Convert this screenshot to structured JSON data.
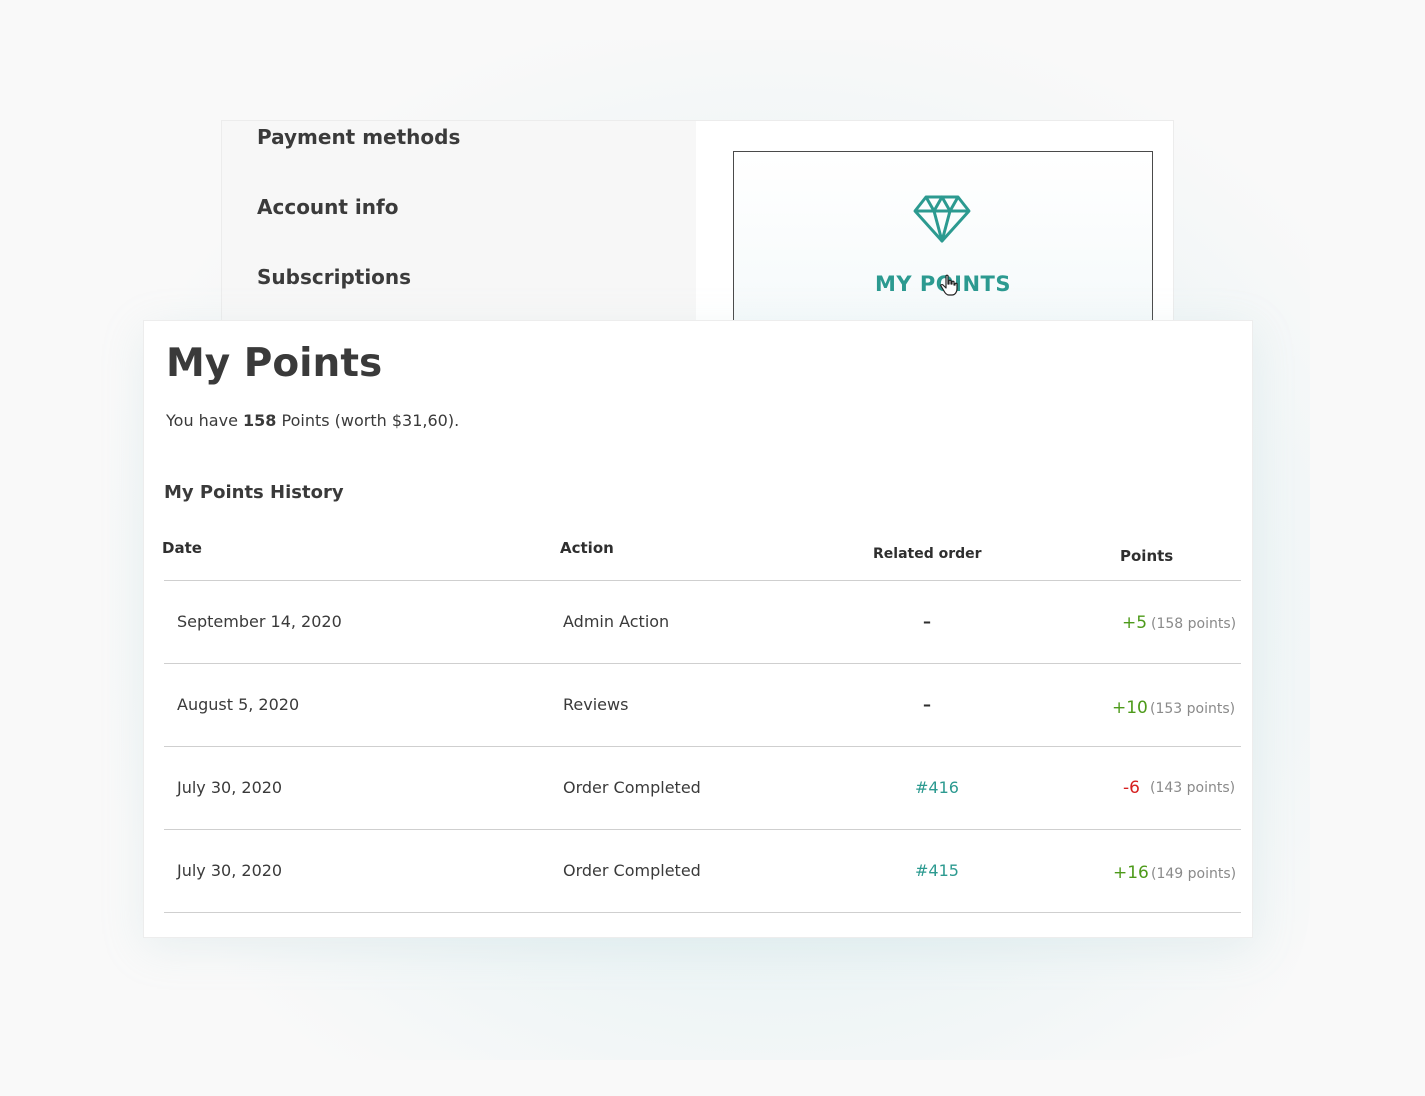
{
  "account_nav": {
    "items": [
      {
        "label": "Payment methods"
      },
      {
        "label": "Account info"
      },
      {
        "label": "Subscriptions"
      }
    ]
  },
  "points_tile": {
    "icon": "diamond-icon",
    "label": "MY POINTS",
    "accent_color": "#2c9a90"
  },
  "page": {
    "title": "My Points",
    "summary_prefix": "You have ",
    "summary_points": "158",
    "summary_suffix": " Points (worth $31,60)."
  },
  "history": {
    "title": "My Points History",
    "columns": {
      "date": "Date",
      "action": "Action",
      "related_order": "Related order",
      "points": "Points"
    },
    "rows": [
      {
        "date": "September 14, 2020",
        "action": "Admin Action",
        "order": "–",
        "points": "+5",
        "total": "(158 points)"
      },
      {
        "date": "August 5, 2020",
        "action": "Reviews",
        "order": "–",
        "points": "+10",
        "total": "(153 points)"
      },
      {
        "date": "July 30, 2020",
        "action": "Order Completed",
        "order": "#416",
        "points": "-6",
        "total": "(143 points)"
      },
      {
        "date": "July 30, 2020",
        "action": "Order Completed",
        "order": "#415",
        "points": "+16",
        "total": "(149 points)"
      }
    ]
  },
  "colors": {
    "positive": "#4d9a1a",
    "negative": "#d62020",
    "link": "#2c9a90"
  }
}
